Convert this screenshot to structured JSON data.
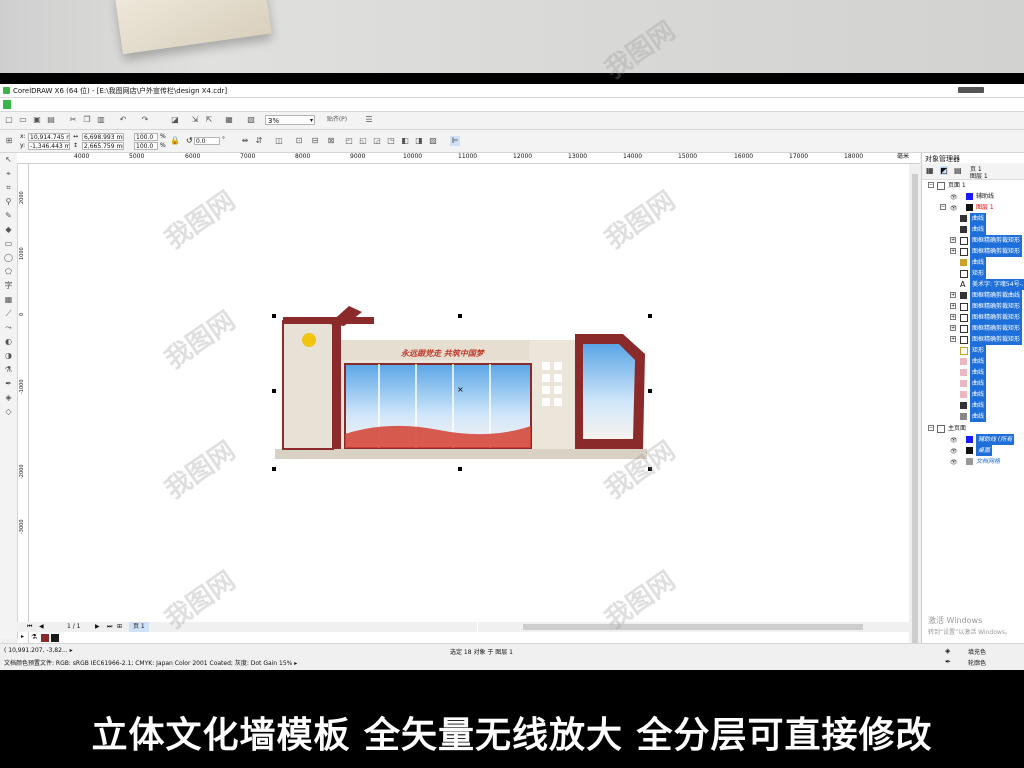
{
  "title": "CorelDRAW X6 (64 位) - [E:\\我图网店\\户外宣传栏\\design X4.cdr]",
  "toolbar": {
    "zoom": "3%",
    "snap_label": "贴齐(P)"
  },
  "props": {
    "x": "10,914.745 mm",
    "y": "-1,346.443 mm",
    "w": "6,698.993 mm",
    "h": "2,665.759 mm",
    "sx": "100.0",
    "sy": "100.0",
    "pct": "%",
    "angle": "0.0",
    "deg": "°"
  },
  "ruler_top": [
    "4000",
    "5000",
    "6000",
    "7000",
    "8000",
    "9000",
    "10000",
    "11000",
    "12000",
    "13000",
    "14000",
    "15000",
    "16000",
    "17000",
    "18000",
    "毫米"
  ],
  "ruler_left": [
    "2000",
    "1000",
    "0",
    "-1000",
    "-2000",
    "-3000"
  ],
  "page_nav": {
    "page_count": "1 / 1",
    "page_tab": "页 1"
  },
  "status": {
    "coords": "( 10,991.207, -3,82... ▸",
    "profile": "文档颜色预置文件: RGB: sRGB IEC61966-2.1; CMYK: Japan Color 2001 Coated; 灰度: Dot Gain 15% ▸",
    "selection": "选定 18 对象 于 图层 1",
    "fill_label": "填充色",
    "outline_label": "轮廓色"
  },
  "object_manager": {
    "header": "对象管理器",
    "top_page": "页 1",
    "top_layer": "图层 1",
    "page1": "页面 1",
    "guides": "辅助线",
    "layer1": "图层 1",
    "items": [
      "曲线",
      "曲线",
      "图框精确剪裁矩形",
      "图框精确剪裁矩形",
      "曲线",
      "矩形",
      "美术字: 字魂54号-...",
      "图框精确剪裁曲线",
      "图框精确剪裁矩形",
      "图框精确剪裁矩形",
      "图框精确剪裁矩形",
      "图框精确剪裁矩形",
      "矩形",
      "曲线",
      "曲线",
      "曲线",
      "曲线",
      "曲线",
      "曲线"
    ],
    "master": "主页面",
    "master_items": [
      "辅助线 (所有",
      "桌面",
      "文档网格"
    ]
  },
  "design": {
    "slogan": "永远跟党走  共筑中国梦"
  },
  "windows_activation": "激活 Windows",
  "windows_activation_sub": "转到“设置”以激活 Windows。",
  "watermark": "我图网",
  "banner_caption": "立体文化墙模板  全矢量无线放大 全分层可直接修改",
  "colors": {
    "frame_red": "#8b2a2a",
    "panel_beige": "#e8e2d6",
    "selection_blue": "#1e6fd9",
    "corel_green": "#3ab54a"
  }
}
